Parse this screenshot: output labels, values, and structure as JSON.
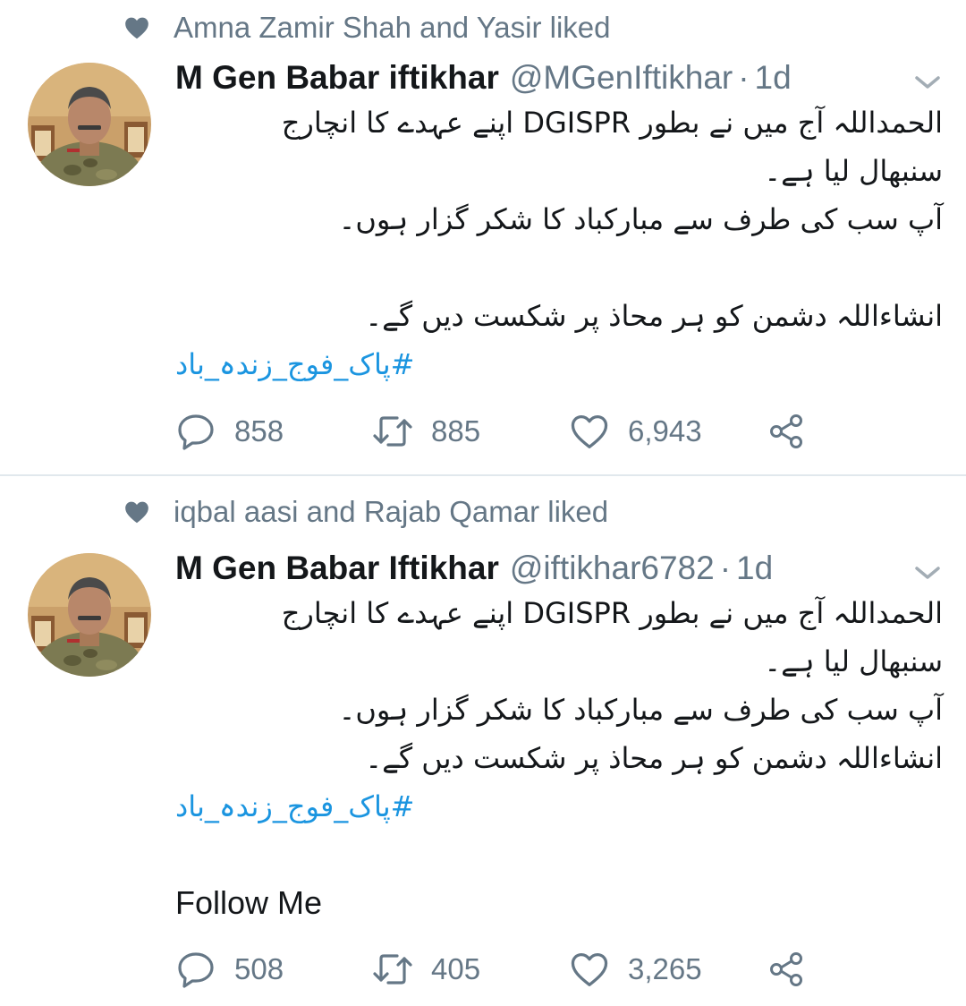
{
  "colors": {
    "link": "#1b95e0",
    "secondary_text": "#657786",
    "primary_text": "#14171a",
    "divider": "#e1e8ed"
  },
  "icons": {
    "context": "heart-icon",
    "reply": "reply-icon",
    "retweet": "retweet-icon",
    "like": "like-icon",
    "share": "share-icon",
    "caret": "chevron-down-icon"
  },
  "tweets": [
    {
      "social_context": "Amna Zamir Shah and Yasir liked",
      "author_name": "M Gen Babar iftikhar",
      "handle": "@MGenIftikhar",
      "separator": "·",
      "time": "1d",
      "lines": [
        "الحمداللہ آج میں نے بطور DGISPR اپنے عہدے کا انچارج",
        "سنبھال لیا ہے۔",
        "آپ سب کی طرف سے مبارکباد کا شکر گزار ہوں۔",
        "",
        "انشاءاللہ دشمن کو ہر محاذ پر شکست دیں گے۔"
      ],
      "hashtag": "#پاک_فوج_زندہ_باد",
      "extra": "",
      "replies": "858",
      "retweets": "885",
      "likes": "6,943"
    },
    {
      "social_context": "iqbal aasi and Rajab Qamar liked",
      "author_name": "M Gen Babar Iftikhar",
      "handle": "@iftikhar6782",
      "separator": "·",
      "time": "1d",
      "lines": [
        "الحمداللہ آج میں نے بطور DGISPR اپنے عہدے کا انچارج",
        "سنبھال لیا ہے۔",
        "آپ سب کی طرف سے مبارکباد کا شکر گزار ہوں۔",
        "انشاءاللہ دشمن کو ہر محاذ پر شکست دیں گے۔"
      ],
      "hashtag": "#پاک_فوج_زندہ_باد",
      "extra": "Follow Me",
      "replies": "508",
      "retweets": "405",
      "likes": "3,265"
    }
  ]
}
